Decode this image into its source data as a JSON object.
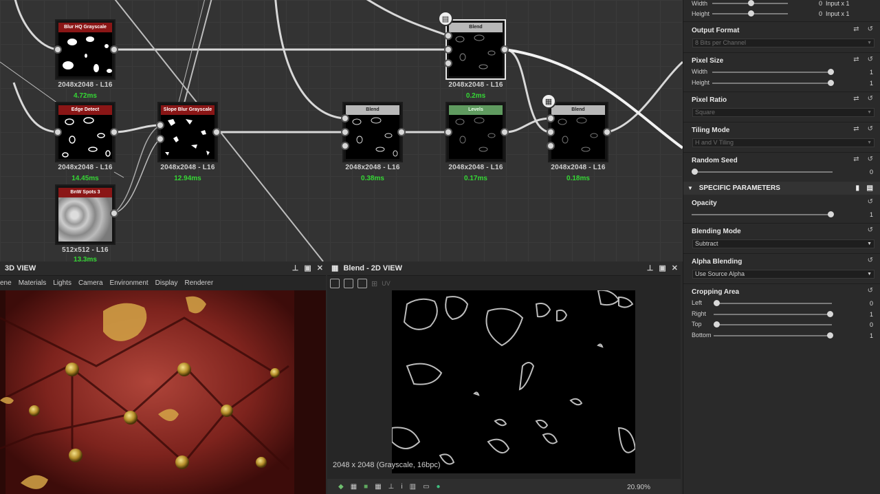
{
  "graph": {
    "nodes": [
      {
        "id": "blur",
        "title": "Blur HQ Grayscale",
        "info": "2048x2048 - L16",
        "time": "4.72ms"
      },
      {
        "id": "edge",
        "title": "Edge Detect",
        "info": "2048x2048 - L16",
        "time": "14.45ms"
      },
      {
        "id": "bnw",
        "title": "BnW Spots 3",
        "info": "512x512 - L16",
        "time": "13.3ms"
      },
      {
        "id": "slope",
        "title": "Slope Blur Grayscale",
        "info": "2048x2048 - L16",
        "time": "12.94ms"
      },
      {
        "id": "blend1",
        "title": "Blend",
        "info": "2048x2048 - L16",
        "time": "0.38ms"
      },
      {
        "id": "levels",
        "title": "Levels",
        "info": "2048x2048 - L16",
        "time": "0.17ms"
      },
      {
        "id": "blend2",
        "title": "Blend",
        "info": "2048x2048 - L16",
        "time": "0.18ms"
      },
      {
        "id": "blendtop",
        "title": "Blend",
        "info": "2048x2048 - L16",
        "time": "0.2ms"
      }
    ]
  },
  "view3d": {
    "title": "3D VIEW",
    "menu": [
      "ene",
      "Materials",
      "Lights",
      "Camera",
      "Environment",
      "Display",
      "Renderer"
    ]
  },
  "view2d": {
    "title": "Blend - 2D VIEW",
    "uv_label": "UV",
    "resolution": "2048 x 2048 (Grayscale, 16bpc)",
    "zoom": "20.90%"
  },
  "props": {
    "top": {
      "width_label": "Width",
      "width_value": "0",
      "width_suffix": "Input x 1",
      "height_label": "Height",
      "height_value": "0",
      "height_suffix": "Input x 1"
    },
    "output_format": {
      "label": "Output Format",
      "value": "8 Bits per Channel"
    },
    "pixel_size": {
      "label": "Pixel Size",
      "width_label": "Width",
      "width_value": "1",
      "height_label": "Height",
      "height_value": "1"
    },
    "pixel_ratio": {
      "label": "Pixel Ratio",
      "value": "Square"
    },
    "tiling_mode": {
      "label": "Tiling Mode",
      "value": "H and V Tiling"
    },
    "random_seed": {
      "label": "Random Seed",
      "value": "0"
    },
    "specific_header": "SPECIFIC PARAMETERS",
    "opacity": {
      "label": "Opacity",
      "value": "1"
    },
    "blending_mode": {
      "label": "Blending Mode",
      "value": "Subtract"
    },
    "alpha_blending": {
      "label": "Alpha Blending",
      "value": "Use Source Alpha"
    },
    "cropping": {
      "label": "Cropping Area",
      "left_label": "Left",
      "left_value": "0",
      "right_label": "Right",
      "right_value": "1",
      "top_label": "Top",
      "top_value": "0",
      "bottom_label": "Bottom",
      "bottom_value": "1"
    }
  },
  "colors": {
    "accent_time": "#35d835",
    "title_red": "#8a1616",
    "title_gray": "#b8b8b8",
    "title_green": "#5f9a5f"
  }
}
